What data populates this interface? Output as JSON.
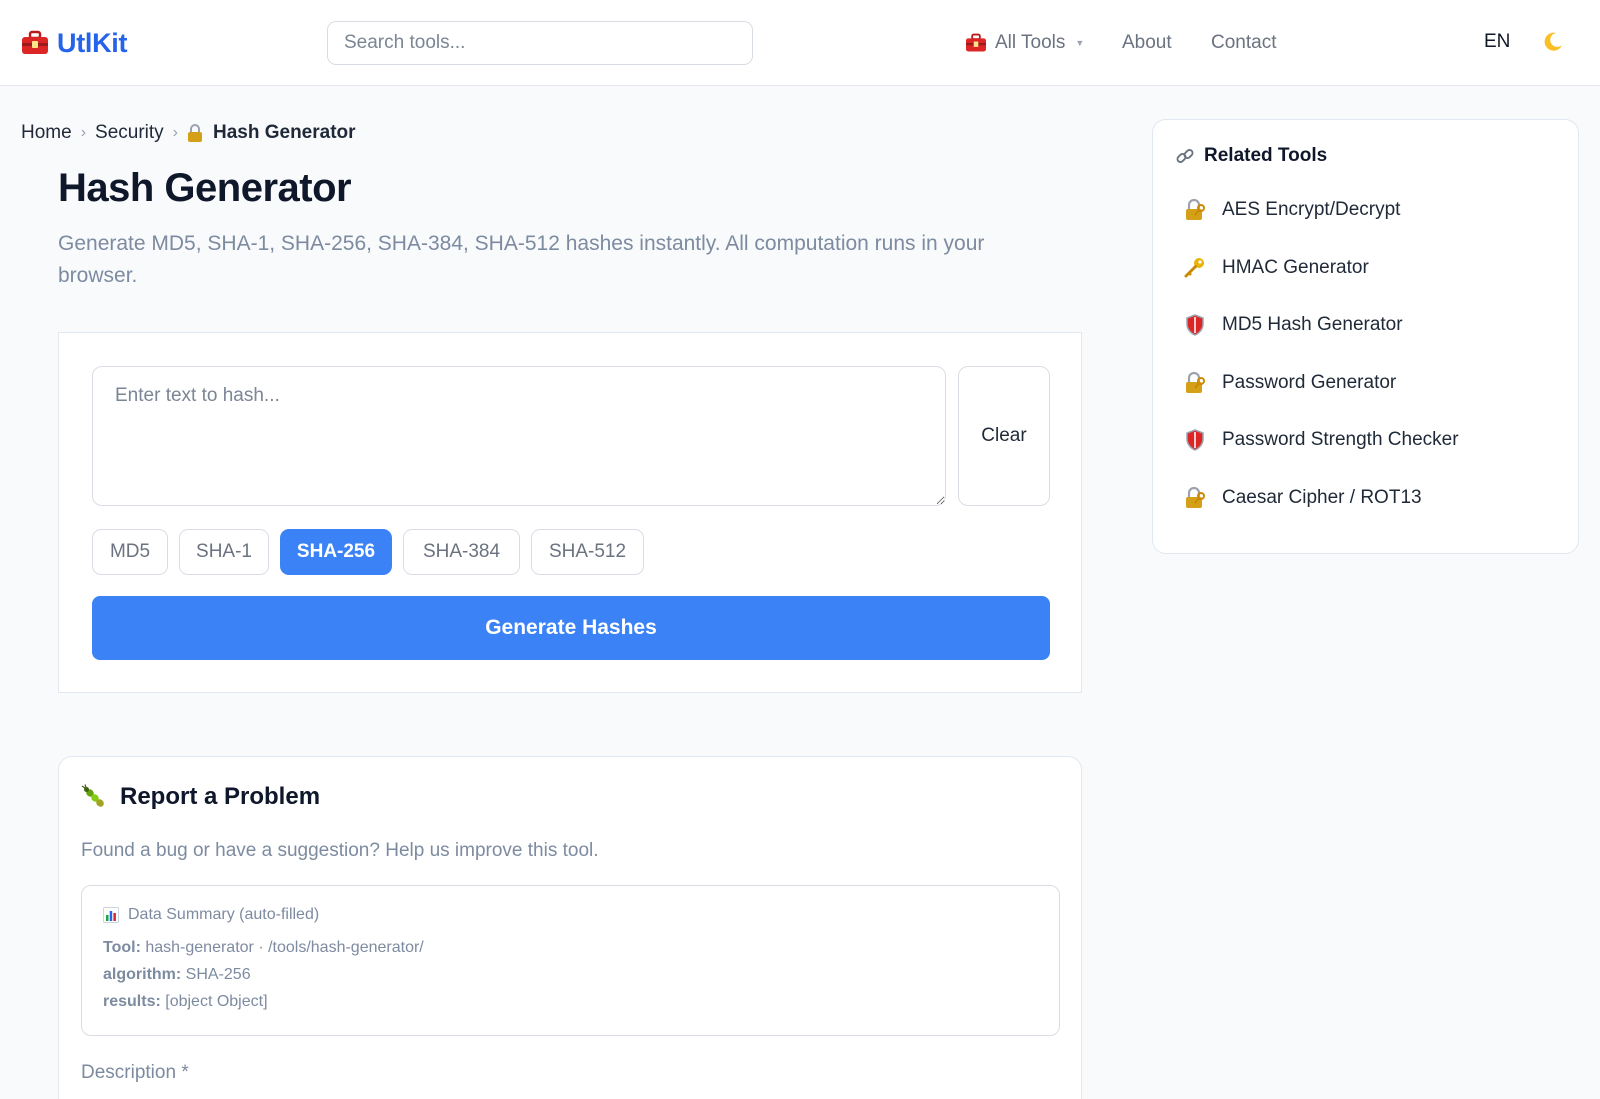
{
  "header": {
    "logo_text": "UtlKit",
    "search_placeholder": "Search tools...",
    "nav": {
      "all_tools": "All Tools",
      "about": "About",
      "contact": "Contact"
    },
    "language": "EN"
  },
  "breadcrumb": {
    "home": "Home",
    "section": "Security",
    "current": "Hash Generator"
  },
  "page": {
    "title": "Hash Generator",
    "description": "Generate MD5, SHA-1, SHA-256, SHA-384, SHA-512 hashes instantly. All computation runs in your browser."
  },
  "tool": {
    "input_placeholder": "Enter text to hash...",
    "input_value": "",
    "clear_label": "Clear",
    "algorithms": [
      "MD5",
      "SHA-1",
      "SHA-256",
      "SHA-384",
      "SHA-512"
    ],
    "selected_algorithm": "SHA-256",
    "generate_label": "Generate Hashes"
  },
  "report": {
    "title": "Report a Problem",
    "description": "Found a bug or have a suggestion? Help us improve this tool.",
    "summary_title": "Data Summary (auto-filled)",
    "tool_label": "Tool:",
    "tool_value": "hash-generator · /tools/hash-generator/",
    "algorithm_label": "algorithm:",
    "algorithm_value": "SHA-256",
    "results_label": "results:",
    "results_value": "[object Object]",
    "description_label": "Description *"
  },
  "related": {
    "title": "Related Tools",
    "items": [
      {
        "label": "AES Encrypt/Decrypt",
        "icon": "lock-key-icon"
      },
      {
        "label": "HMAC Generator",
        "icon": "key-icon"
      },
      {
        "label": "MD5 Hash Generator",
        "icon": "shield-icon"
      },
      {
        "label": "Password Generator",
        "icon": "lock-key-icon"
      },
      {
        "label": "Password Strength Checker",
        "icon": "shield-icon"
      },
      {
        "label": "Caesar Cipher / ROT13",
        "icon": "lock-key-icon"
      }
    ]
  },
  "colors": {
    "accent": "#3b82f6",
    "brand": "#2563eb",
    "muted_text": "#7d8ba0",
    "border": "#e2e8f0"
  }
}
